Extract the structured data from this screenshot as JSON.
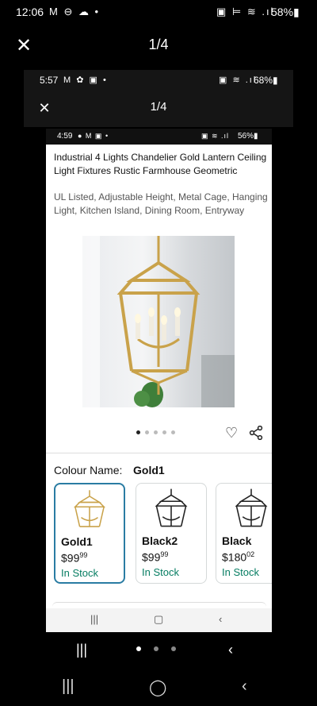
{
  "outer": {
    "status": {
      "time": "12:06",
      "left_icons": "M ⊖ ☁ •",
      "right_icons": "▣ ⊨ ≋ .ıl",
      "battery": "58%▮"
    },
    "header": {
      "close_icon": "close-icon",
      "counter": "1/4"
    },
    "nav": {
      "recent": "|||",
      "home": "◯",
      "back": "‹"
    },
    "page_dots": 3
  },
  "second": {
    "status": {
      "time": "5:57",
      "left_icons": "M ✿ ▣ •",
      "right_icons": "▣ ≋ .ıl",
      "battery": "68%▮"
    },
    "header": {
      "counter": "1/4"
    }
  },
  "inner": {
    "status": {
      "time": "4:59",
      "left_icons": "● M ▣ •",
      "right_icons": "▣ ≋ .ıl",
      "battery": "56%▮"
    },
    "product": {
      "title": "Industrial 4 Lights Chandelier Gold Lantern Ceiling Light Fixtures Rustic Farmhouse Geometric",
      "subtitle": "UL Listed, Adjustable Height, Metal Cage, Hanging Light, Kitchen Island, Dining Room, Entryway"
    },
    "carousel": {
      "count": 5,
      "active": 0
    },
    "colour": {
      "label": "Colour Name:",
      "value": "Gold1"
    },
    "variants": [
      {
        "name": "Gold1",
        "price_main": "$99",
        "price_cents": "99",
        "stock": "In Stock",
        "color": "#c9a24a",
        "selected": true
      },
      {
        "name": "Black2",
        "price_main": "$99",
        "price_cents": "99",
        "stock": "In Stock",
        "color": "#222222",
        "selected": false
      },
      {
        "name": "Black",
        "price_main": "$180",
        "price_cents": "02",
        "stock": "In Stock",
        "color": "#222222",
        "selected": false
      }
    ],
    "nav": {
      "recent": "|||",
      "home": "▢",
      "back": "‹"
    }
  },
  "colors": {
    "accent": "#2a7ca3",
    "stock_green": "#067d62",
    "gold": "#c9a24a"
  }
}
